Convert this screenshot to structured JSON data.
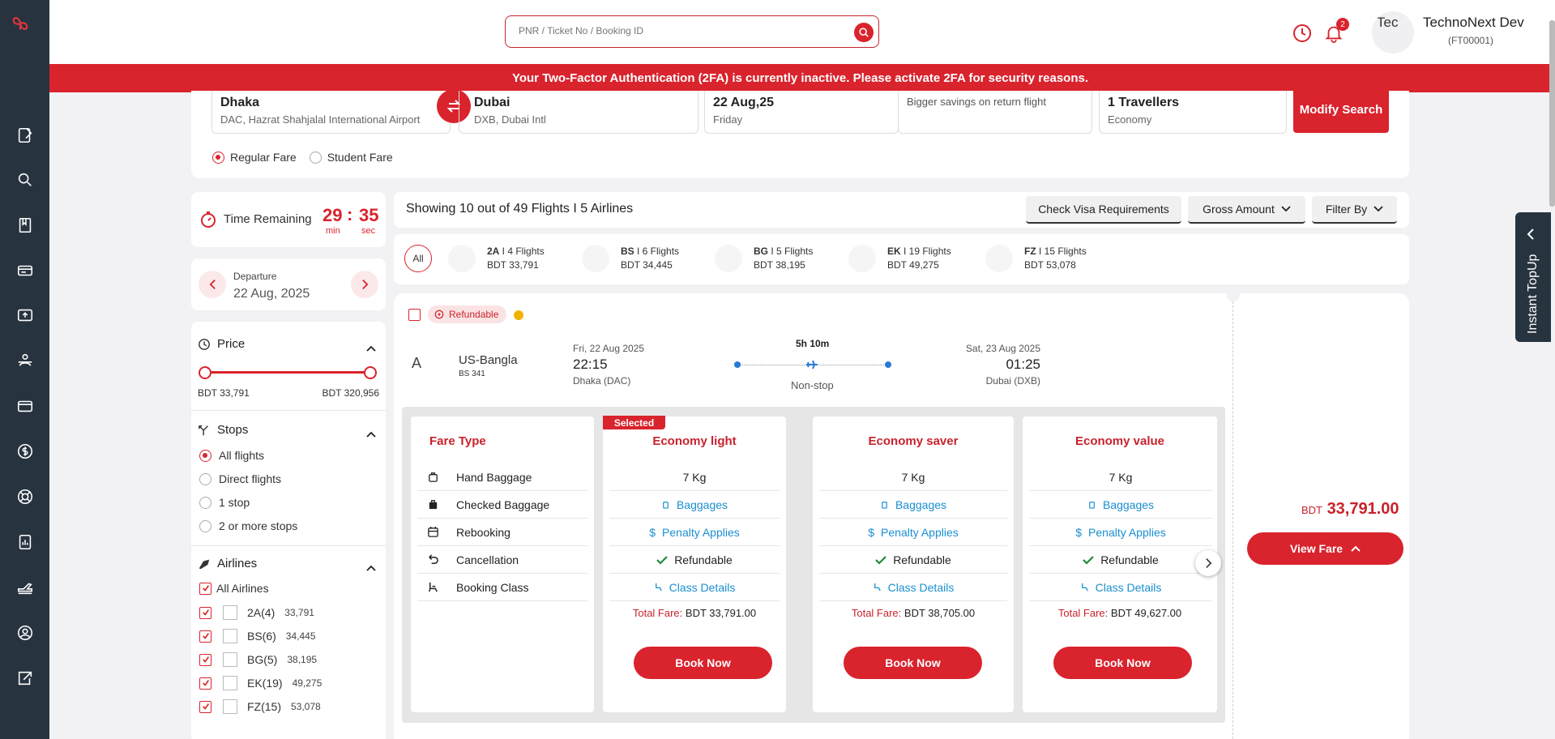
{
  "colors": {
    "brand_red": "#d9232d",
    "rail_bg": "#273440",
    "link_blue": "#1a8fd0",
    "warning_yellow": "#f0b400"
  },
  "search": {
    "placeholder": "PNR / Ticket No / Booking ID"
  },
  "header": {
    "notification_count": "2",
    "avatar_alt": "Tec",
    "user_name": "TechnoNext Dev",
    "user_id": "(FT00001)"
  },
  "banner": {
    "text": "Your Two-Factor Authentication (2FA) is currently inactive. Please activate 2FA for security reasons."
  },
  "trip": {
    "from_city": "Dhaka",
    "from_airport": "DAC, Hazrat Shahjalal International Airport",
    "to_city": "Dubai",
    "to_airport": "DXB, Dubai Intl",
    "date": "22 Aug,25",
    "day": "Friday",
    "return_hint": "Bigger savings on return flight",
    "travellers": "1 Travellers",
    "cabin": "Economy",
    "modify_label": "Modify Search",
    "fare_options": [
      "Regular Fare",
      "Student Fare"
    ],
    "selected_fare": "Regular Fare"
  },
  "timer": {
    "label": "Time Remaining",
    "minutes": "29",
    "seconds": "35",
    "min_unit": "min",
    "sec_unit": "sec",
    "colon": ":"
  },
  "departure": {
    "label": "Departure",
    "date": "22 Aug, 2025"
  },
  "filters": {
    "price": {
      "title": "Price",
      "min": "BDT 33,791",
      "max": "BDT 320,956"
    },
    "stops": {
      "title": "Stops",
      "options": [
        "All flights",
        "Direct flights",
        "1 stop",
        "2 or more stops"
      ],
      "selected": "All flights"
    },
    "airlines": {
      "title": "Airlines",
      "all_label": "All Airlines",
      "items": [
        {
          "label": "2A(4)",
          "price": "33,791"
        },
        {
          "label": "BS(6)",
          "price": "34,445"
        },
        {
          "label": "BG(5)",
          "price": "38,195"
        },
        {
          "label": "EK(19)",
          "price": "49,275"
        },
        {
          "label": "FZ(15)",
          "price": "53,078"
        }
      ]
    }
  },
  "results": {
    "summary": "Showing 10 out of 49 Flights I 5 Airlines",
    "visa_btn": "Check Visa Requirements",
    "amount_btn": "Gross Amount",
    "filter_btn": "Filter By",
    "all_label": "All",
    "airlines": [
      {
        "code": "2A",
        "flights": " I 4 Flights",
        "price": "BDT 33,791"
      },
      {
        "code": "BS",
        "flights": " I 6 Flights",
        "price": "BDT 34,445"
      },
      {
        "code": "BG",
        "flights": " I 5 Flights",
        "price": "BDT 38,195"
      },
      {
        "code": "EK",
        "flights": " I 19 Flights",
        "price": "BDT 49,275"
      },
      {
        "code": "FZ",
        "flights": " I 15 Flights",
        "price": "BDT 53,078"
      }
    ]
  },
  "flight": {
    "refundable_tag": "Refundable",
    "airline_logo_alt": "A",
    "airline": "US-Bangla",
    "flight_no": "BS 341",
    "dep_date": "Fri, 22 Aug 2025",
    "dep_time": "22:15",
    "dep_city": "Dhaka (DAC)",
    "duration": "5h 10m",
    "stops": "Non-stop",
    "arr_date": "Sat, 23 Aug 2025",
    "arr_time": "01:25",
    "arr_city": "Dubai (DXB)",
    "price_currency": "BDT",
    "price_amount": "33,791.00",
    "view_fare": "View Fare"
  },
  "fares": {
    "type_title": "Fare Type",
    "row_labels": [
      "Hand Baggage",
      "Checked Baggage",
      "Rebooking",
      "Cancellation",
      "Booking Class"
    ],
    "selected_tag": "Selected",
    "total_label": "Total Fare:",
    "book_label": "Book Now",
    "columns": [
      {
        "name": "Economy light",
        "hand": "7 Kg",
        "checked": "Baggages",
        "rebook": "Penalty Applies",
        "cancel": "Refundable",
        "cls": "Class Details",
        "total": "BDT 33,791.00"
      },
      {
        "name": "Economy saver",
        "hand": "7 Kg",
        "checked": "Baggages",
        "rebook": "Penalty Applies",
        "cancel": "Refundable",
        "cls": "Class Details",
        "total": "BDT 38,705.00"
      },
      {
        "name": "Economy value",
        "hand": "7 Kg",
        "checked": "Baggages",
        "rebook": "Penalty Applies",
        "cancel": "Refundable",
        "cls": "Class Details",
        "total": "BDT 49,627.00"
      }
    ]
  },
  "topup": {
    "label": "Instant TopUp"
  }
}
